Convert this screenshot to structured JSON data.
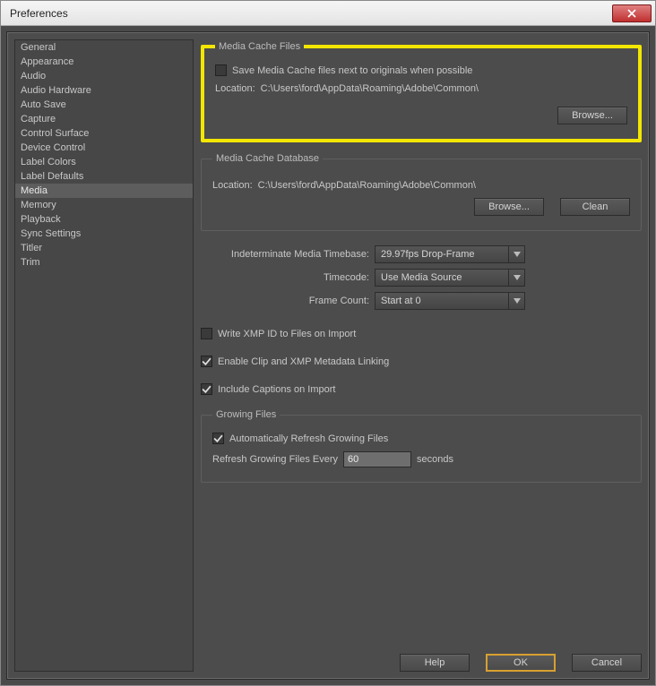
{
  "window": {
    "title": "Preferences"
  },
  "sidebar": {
    "items": [
      {
        "label": "General"
      },
      {
        "label": "Appearance"
      },
      {
        "label": "Audio"
      },
      {
        "label": "Audio Hardware"
      },
      {
        "label": "Auto Save"
      },
      {
        "label": "Capture"
      },
      {
        "label": "Control Surface"
      },
      {
        "label": "Device Control"
      },
      {
        "label": "Label Colors"
      },
      {
        "label": "Label Defaults"
      },
      {
        "label": "Media"
      },
      {
        "label": "Memory"
      },
      {
        "label": "Playback"
      },
      {
        "label": "Sync Settings"
      },
      {
        "label": "Titler"
      },
      {
        "label": "Trim"
      }
    ],
    "selected_index": 10
  },
  "media_cache_files": {
    "title": "Media Cache Files",
    "save_next_label": "Save Media Cache files next to originals when possible",
    "save_next_checked": false,
    "location_label": "Location:",
    "location_value": "C:\\Users\\ford\\AppData\\Roaming\\Adobe\\Common\\",
    "browse_label": "Browse..."
  },
  "media_cache_db": {
    "title": "Media Cache Database",
    "location_label": "Location:",
    "location_value": "C:\\Users\\ford\\AppData\\Roaming\\Adobe\\Common\\",
    "browse_label": "Browse...",
    "clean_label": "Clean"
  },
  "settings": {
    "timebase_label": "Indeterminate Media Timebase:",
    "timebase_value": "29.97fps Drop-Frame",
    "timecode_label": "Timecode:",
    "timecode_value": "Use Media Source",
    "framecount_label": "Frame Count:",
    "framecount_value": "Start at 0",
    "write_xmp_label": "Write XMP ID to Files on Import",
    "write_xmp_checked": false,
    "enable_clip_label": "Enable Clip and XMP Metadata Linking",
    "enable_clip_checked": true,
    "include_captions_label": "Include Captions on Import",
    "include_captions_checked": true
  },
  "growing": {
    "title": "Growing Files",
    "auto_refresh_label": "Automatically Refresh Growing Files",
    "auto_refresh_checked": true,
    "refresh_every_label": "Refresh Growing Files Every",
    "refresh_value": "60",
    "seconds_label": "seconds"
  },
  "footer": {
    "help": "Help",
    "ok": "OK",
    "cancel": "Cancel"
  }
}
